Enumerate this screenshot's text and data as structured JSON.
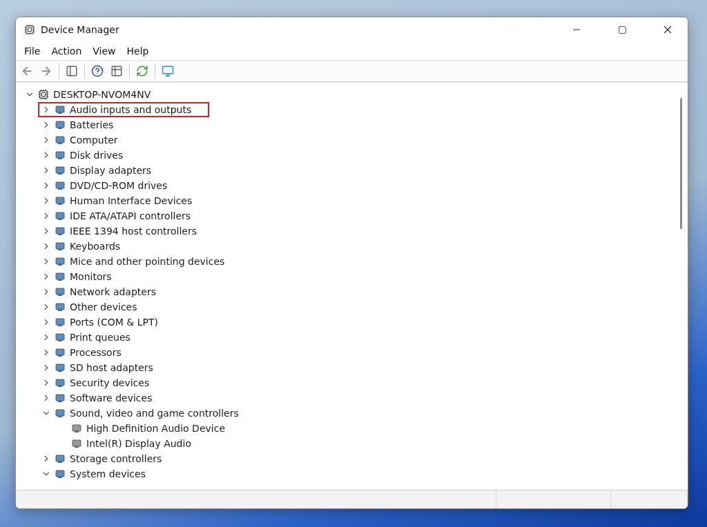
{
  "window": {
    "title": "Device Manager"
  },
  "menu": [
    "File",
    "Action",
    "View",
    "Help"
  ],
  "tree": {
    "label": "DESKTOP-NVOM4NV",
    "expanded": true,
    "highlighted": false,
    "children": [
      {
        "label": "Audio inputs and outputs",
        "expanded": false,
        "highlighted": true
      },
      {
        "label": "Batteries",
        "expanded": false,
        "highlighted": false
      },
      {
        "label": "Computer",
        "expanded": false,
        "highlighted": false
      },
      {
        "label": "Disk drives",
        "expanded": false,
        "highlighted": false
      },
      {
        "label": "Display adapters",
        "expanded": false,
        "highlighted": false
      },
      {
        "label": "DVD/CD-ROM drives",
        "expanded": false,
        "highlighted": false
      },
      {
        "label": "Human Interface Devices",
        "expanded": false,
        "highlighted": false
      },
      {
        "label": "IDE ATA/ATAPI controllers",
        "expanded": false,
        "highlighted": false
      },
      {
        "label": "IEEE 1394 host controllers",
        "expanded": false,
        "highlighted": false
      },
      {
        "label": "Keyboards",
        "expanded": false,
        "highlighted": false
      },
      {
        "label": "Mice and other pointing devices",
        "expanded": false,
        "highlighted": false
      },
      {
        "label": "Monitors",
        "expanded": false,
        "highlighted": false
      },
      {
        "label": "Network adapters",
        "expanded": false,
        "highlighted": false
      },
      {
        "label": "Other devices",
        "expanded": false,
        "highlighted": false
      },
      {
        "label": "Ports (COM & LPT)",
        "expanded": false,
        "highlighted": false
      },
      {
        "label": "Print queues",
        "expanded": false,
        "highlighted": false
      },
      {
        "label": "Processors",
        "expanded": false,
        "highlighted": false
      },
      {
        "label": "SD host adapters",
        "expanded": false,
        "highlighted": false
      },
      {
        "label": "Security devices",
        "expanded": false,
        "highlighted": false
      },
      {
        "label": "Software devices",
        "expanded": false,
        "highlighted": false
      },
      {
        "label": "Sound, video and game controllers",
        "expanded": true,
        "highlighted": false,
        "children": [
          {
            "label": "High Definition Audio Device",
            "highlighted": false
          },
          {
            "label": "Intel(R) Display Audio",
            "highlighted": false
          }
        ]
      },
      {
        "label": "Storage controllers",
        "expanded": false,
        "highlighted": false
      },
      {
        "label": "System devices",
        "expanded": true,
        "highlighted": false
      }
    ]
  }
}
